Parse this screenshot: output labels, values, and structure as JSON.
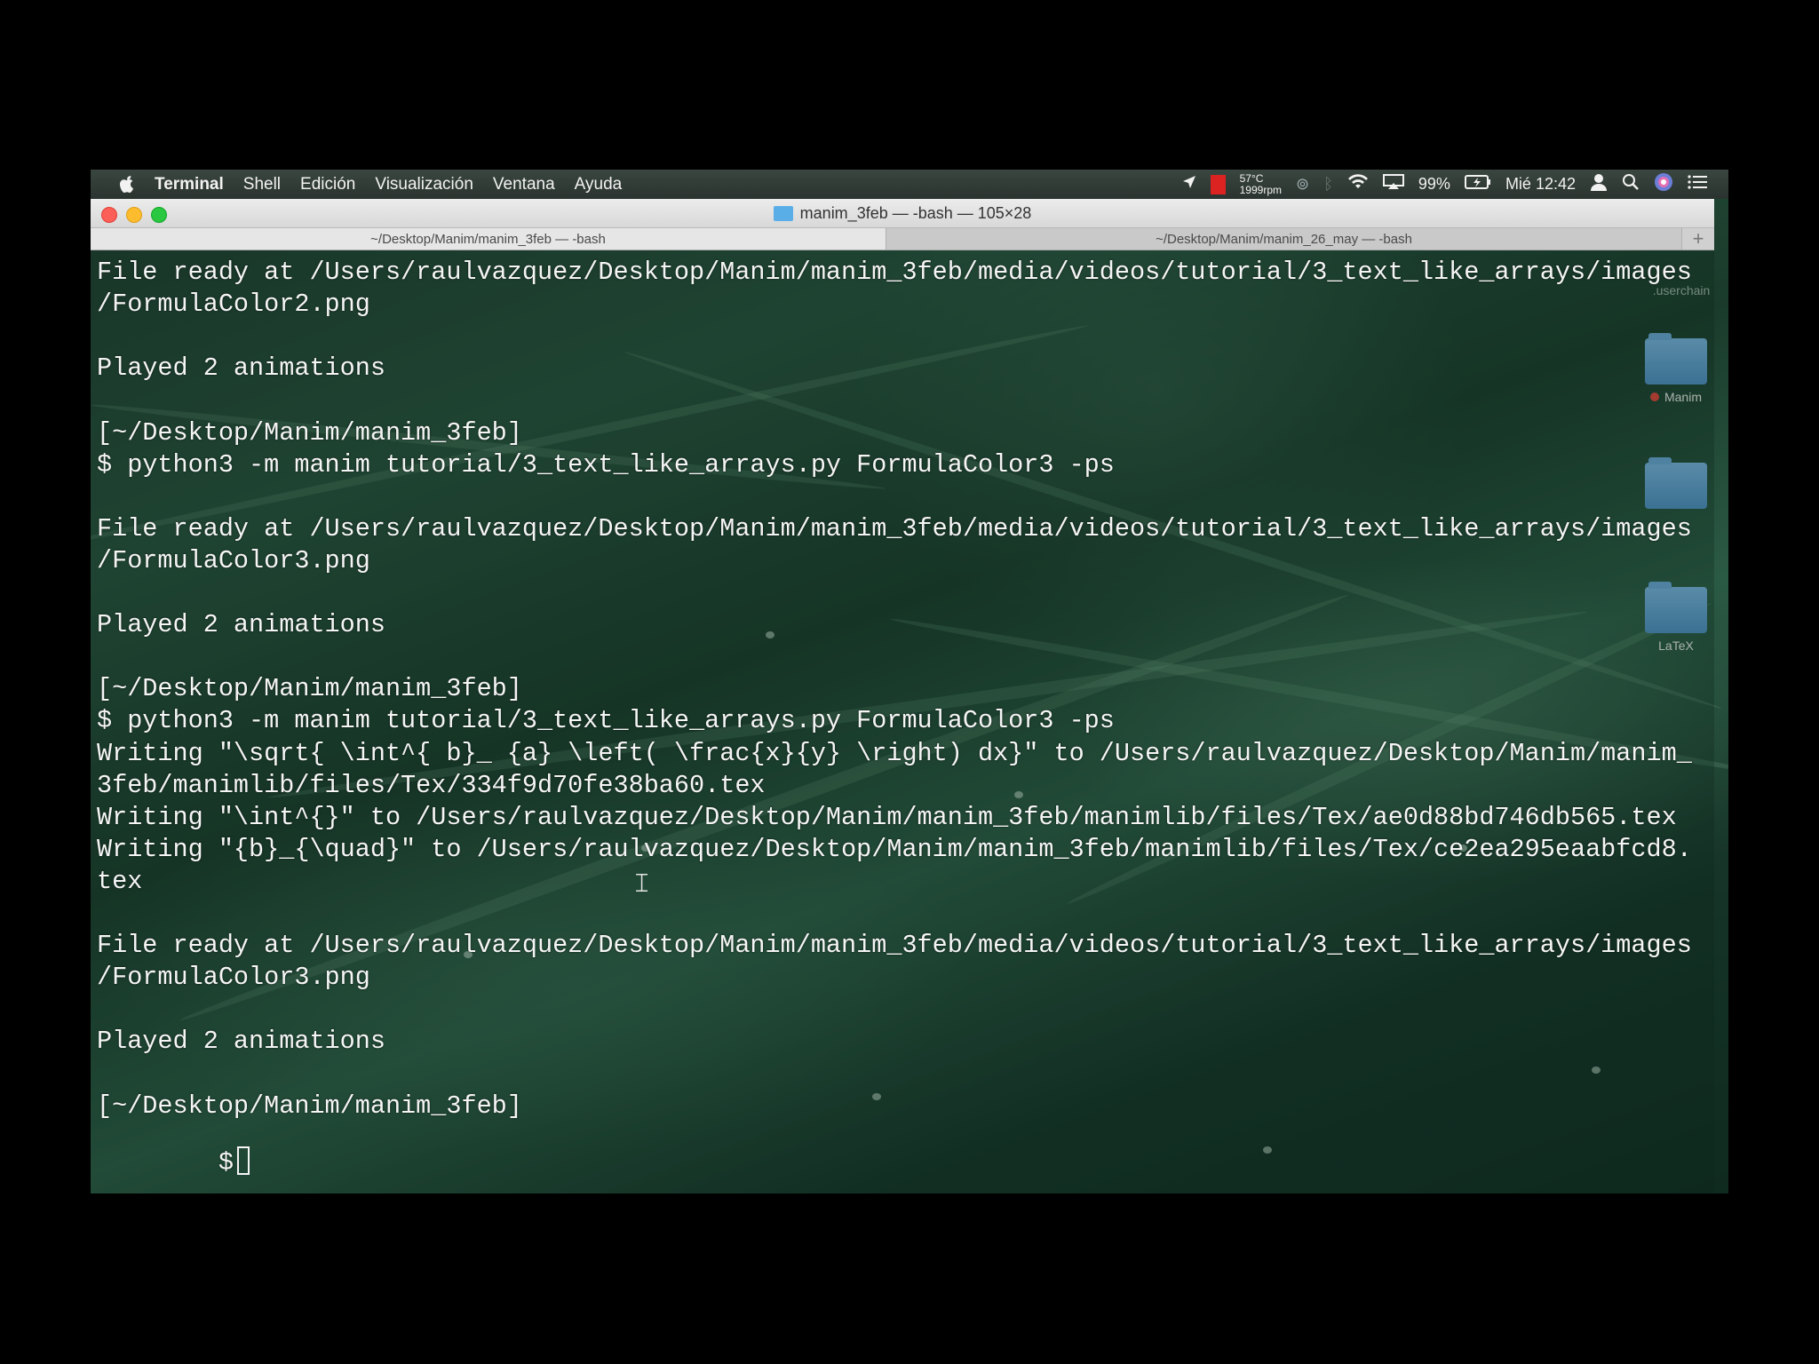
{
  "menubar": {
    "apple_icon": "apple-icon",
    "app_name": "Terminal",
    "items": [
      "Shell",
      "Edición",
      "Visualización",
      "Ventana",
      "Ayuda"
    ],
    "status": {
      "temp": "57°C",
      "rpm": "1999rpm",
      "battery": "99%",
      "clock": "Mié 12:42"
    }
  },
  "window": {
    "title": "manim_3feb — -bash — 105×28",
    "tabs": [
      {
        "label": "~/Desktop/Manim/manim_3feb — -bash",
        "active": true
      },
      {
        "label": "~/Desktop/Manim/manim_26_may — -bash",
        "active": false
      }
    ],
    "new_tab": "+"
  },
  "terminal": {
    "lines": [
      "File ready at /Users/raulvazquez/Desktop/Manim/manim_3feb/media/videos/tutorial/3_text_like_arrays/images",
      "/FormulaColor2.png",
      "",
      "Played 2 animations",
      "",
      "[~/Desktop/Manim/manim_3feb]",
      "$ python3 -m manim tutorial/3_text_like_arrays.py FormulaColor3 -ps",
      "",
      "File ready at /Users/raulvazquez/Desktop/Manim/manim_3feb/media/videos/tutorial/3_text_like_arrays/images",
      "/FormulaColor3.png",
      "",
      "Played 2 animations",
      "",
      "[~/Desktop/Manim/manim_3feb]",
      "$ python3 -m manim tutorial/3_text_like_arrays.py FormulaColor3 -ps",
      "Writing \"\\sqrt{ \\int^{ b}_ {a} \\left( \\frac{x}{y} \\right) dx}\" to /Users/raulvazquez/Desktop/Manim/manim_",
      "3feb/manimlib/files/Tex/334f9d70fe38ba60.tex",
      "Writing \"\\int^{}\" to /Users/raulvazquez/Desktop/Manim/manim_3feb/manimlib/files/Tex/ae0d88bd746db565.tex",
      "Writing \"{b}_{\\quad}\" to /Users/raulvazquez/Desktop/Manim/manim_3feb/manimlib/files/Tex/ce2ea295eaabfcd8.",
      "tex",
      "",
      "File ready at /Users/raulvazquez/Desktop/Manim/manim_3feb/media/videos/tutorial/3_text_like_arrays/images",
      "/FormulaColor3.png",
      "",
      "Played 2 animations",
      "",
      "[~/Desktop/Manim/manim_3feb]"
    ],
    "prompt": "$"
  },
  "desktop": {
    "icons": [
      {
        "label": ".userchain"
      },
      {
        "label": "Manim"
      },
      {
        "label": ""
      },
      {
        "label": "LaTeX"
      }
    ]
  }
}
